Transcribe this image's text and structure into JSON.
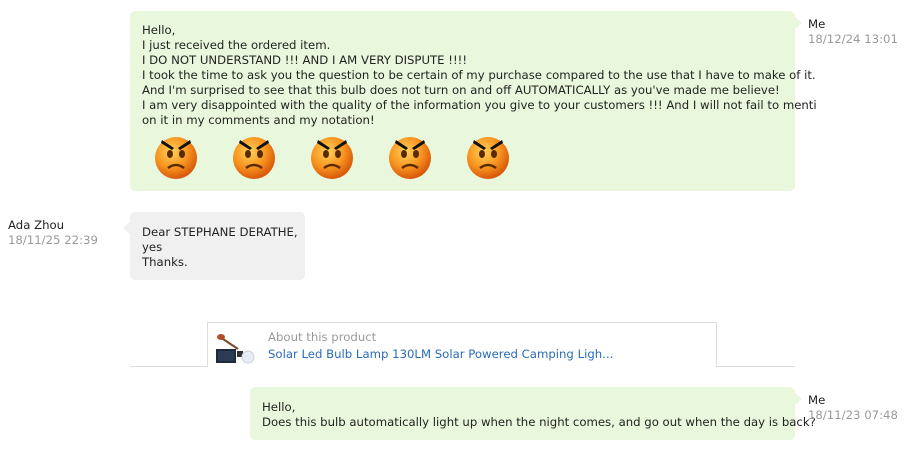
{
  "messages": [
    {
      "sender": "Me",
      "time": "18/12/24 13:01",
      "lines": [
        "Hello,",
        "I just received the ordered item.",
        "I DO NOT UNDERSTAND !!! AND I AM VERY DISPUTE !!!!",
        "I took the time to ask you the question to be certain of my purchase compared to the use that I have to make of it.",
        "And I'm surprised to see that this bulb does not turn on and off AUTOMATICALLY as you've made me believe!",
        "I am very disappointed with the quality of the information you give to your customers !!! And I will not fail to menti",
        "on it in my comments and my notation!"
      ],
      "emoji_icon": "angry-face-icon",
      "emoji_count": 5
    },
    {
      "sender": "Ada Zhou",
      "time": "18/11/25 22:39",
      "lines": [
        "Dear STEPHANE DERATHE,",
        "yes",
        "Thanks."
      ]
    },
    {
      "sender": "Me",
      "time": "18/11/23 07:48",
      "lines": [
        "Hello,",
        "Does this bulb automatically light up when the night comes, and go out when the day is back?"
      ]
    }
  ],
  "product": {
    "label": "About this product",
    "title": "Solar Led Bulb Lamp 130LM Solar Powered Camping Ligh...",
    "thumbnail_icon": "solar-bulb-thumbnail-icon",
    "link_color": "#2a6bb8"
  },
  "colors": {
    "my_bubble": "#e9f8dc",
    "other_bubble": "#f0f0f0",
    "timestamp": "#9a9a9a",
    "emoji_face": "#f7931e"
  }
}
